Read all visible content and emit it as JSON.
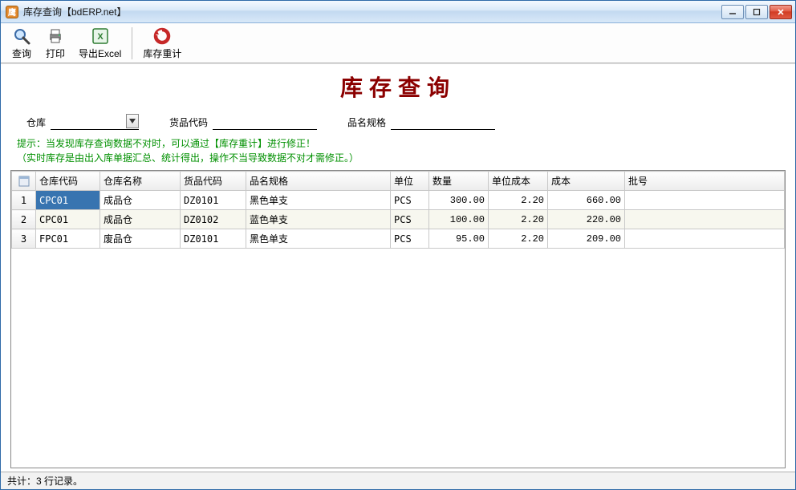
{
  "window": {
    "title": "库存查询【bdERP.net】",
    "app_icon_text": "鹰"
  },
  "toolbar": {
    "query": "查询",
    "print": "打印",
    "export": "导出Excel",
    "recalc": "库存重计"
  },
  "page": {
    "title": "库存查询"
  },
  "filters": {
    "warehouse_label": "仓库",
    "warehouse_value": "",
    "product_code_label": "货品代码",
    "product_code_value": "",
    "product_name_label": "品名规格",
    "product_name_value": ""
  },
  "hint": {
    "line1": "提示：当发现库存查询数据不对时，可以通过【库存重计】进行修正！",
    "line2": "（实时库存是由出入库单据汇总、统计得出，操作不当导致数据不对才需修正。）"
  },
  "grid": {
    "headers": {
      "row": "",
      "wcode": "仓库代码",
      "wname": "仓库名称",
      "pcode": "货品代码",
      "pname": "品名规格",
      "unit": "单位",
      "qty": "数量",
      "ucost": "单位成本",
      "cost": "成本",
      "lot": "批号"
    },
    "rows": [
      {
        "n": "1",
        "wcode": "CPC01",
        "wname": "成品仓",
        "pcode": "DZ0101",
        "pname": "黑色单支",
        "unit": "PCS",
        "qty": "300.00",
        "ucost": "2.20",
        "cost": "660.00",
        "lot": ""
      },
      {
        "n": "2",
        "wcode": "CPC01",
        "wname": "成品仓",
        "pcode": "DZ0102",
        "pname": "蓝色单支",
        "unit": "PCS",
        "qty": "100.00",
        "ucost": "2.20",
        "cost": "220.00",
        "lot": ""
      },
      {
        "n": "3",
        "wcode": "FPC01",
        "wname": "废品仓",
        "pcode": "DZ0101",
        "pname": "黑色单支",
        "unit": "PCS",
        "qty": "95.00",
        "ucost": "2.20",
        "cost": "209.00",
        "lot": ""
      }
    ]
  },
  "statusbar": {
    "text": "共计：3 行记录。"
  }
}
